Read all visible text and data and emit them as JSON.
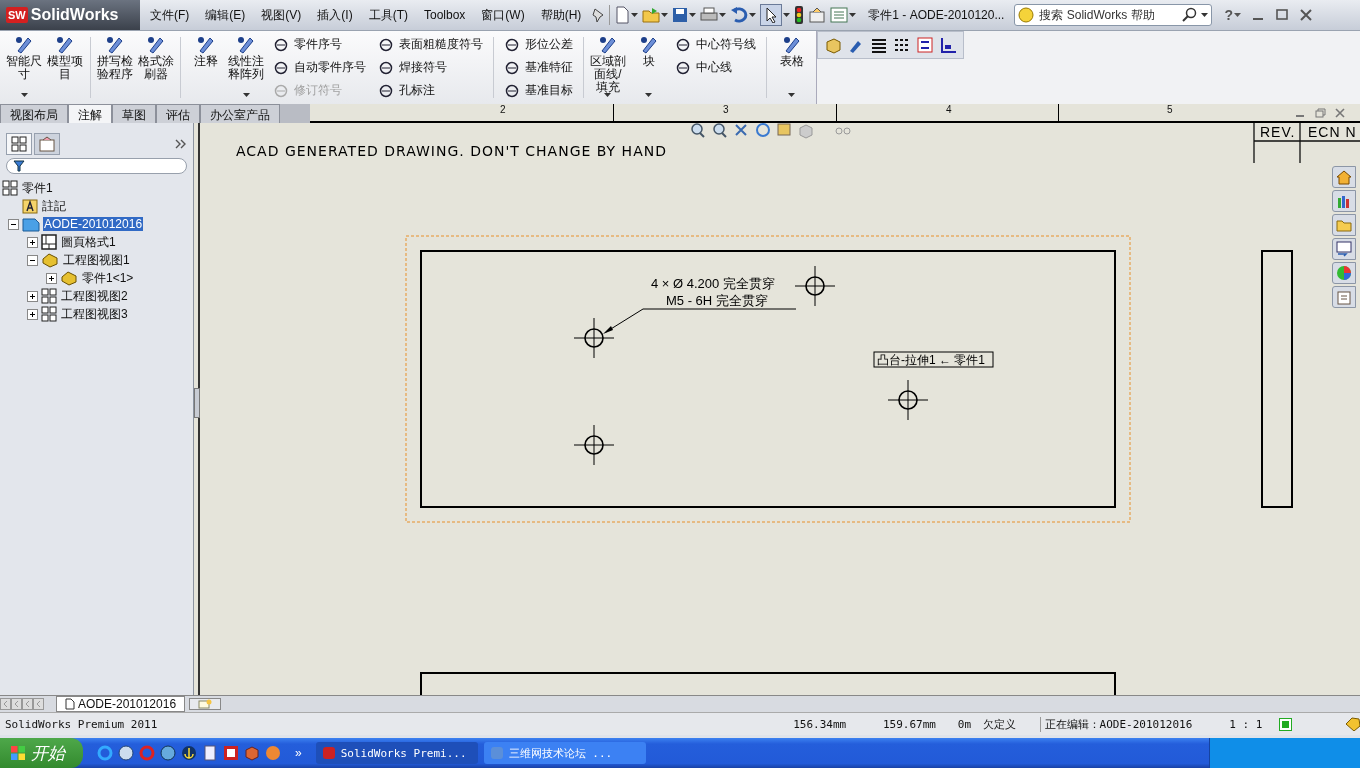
{
  "app": {
    "logo_mark": "SW",
    "logo_name": "SolidWorks"
  },
  "menu": [
    {
      "label": "文件(F)"
    },
    {
      "label": "编辑(E)"
    },
    {
      "label": "视图(V)"
    },
    {
      "label": "插入(I)"
    },
    {
      "label": "工具(T)"
    },
    {
      "label": "Toolbox"
    },
    {
      "label": "窗口(W)"
    },
    {
      "label": "帮助(H)"
    }
  ],
  "document_title": "零件1 - AODE-2010120...",
  "search": {
    "placeholder": "搜索 SolidWorks 帮助"
  },
  "help_button": "?",
  "ribbon": [
    {
      "kind": "large",
      "label": "智能尺寸",
      "caret": true
    },
    {
      "kind": "large",
      "label": "模型项目",
      "caret": false
    },
    {
      "kind": "divider"
    },
    {
      "kind": "large",
      "label": "拼写检验程序",
      "caret": false
    },
    {
      "kind": "large",
      "label": "格式涂刷器",
      "caret": false
    },
    {
      "kind": "divider"
    },
    {
      "kind": "large",
      "label": "注释",
      "caret": false
    },
    {
      "kind": "large",
      "label": "线性注释阵列",
      "caret": true
    },
    {
      "kind": "stack",
      "items": [
        {
          "label": "零件序号",
          "disabled": false
        },
        {
          "label": "自动零件序号",
          "disabled": false
        },
        {
          "label": "修订符号",
          "disabled": true
        }
      ]
    },
    {
      "kind": "stack",
      "items": [
        {
          "label": "表面粗糙度符号",
          "disabled": false
        },
        {
          "label": "焊接符号",
          "disabled": false
        },
        {
          "label": "孔标注",
          "disabled": false
        }
      ]
    },
    {
      "kind": "divider"
    },
    {
      "kind": "stack",
      "items": [
        {
          "label": "形位公差",
          "disabled": false
        },
        {
          "label": "基准特征",
          "disabled": false
        },
        {
          "label": "基准目标",
          "disabled": false
        }
      ]
    },
    {
      "kind": "divider"
    },
    {
      "kind": "large",
      "label": "区域剖面线/填充",
      "caret": true
    },
    {
      "kind": "large",
      "label": "块",
      "caret": true
    },
    {
      "kind": "stack",
      "items": [
        {
          "label": "中心符号线",
          "disabled": false
        },
        {
          "label": "中心线",
          "disabled": false
        }
      ]
    },
    {
      "kind": "divider"
    },
    {
      "kind": "large",
      "label": "表格",
      "caret": true
    }
  ],
  "command_tabs": [
    {
      "label": "视图布局",
      "selected": false
    },
    {
      "label": "注解",
      "selected": true
    },
    {
      "label": "草图",
      "selected": false
    },
    {
      "label": "评估",
      "selected": false
    },
    {
      "label": "办公室产品",
      "selected": false
    }
  ],
  "ruler_labels": [
    "2",
    "3",
    "4",
    "5"
  ],
  "tree": [
    {
      "label": "零件1",
      "kind": "drawing",
      "selected": false,
      "children": [
        {
          "label": "註記",
          "kind": "notes",
          "selected": false
        },
        {
          "label": "AODE-201012016",
          "kind": "sheet",
          "selected": true,
          "expanded": true,
          "children": [
            {
              "label": "圖頁格式1",
              "kind": "format",
              "selected": false,
              "expanded": false
            },
            {
              "label": "工程图视图1",
              "kind": "part",
              "selected": false,
              "expanded": true,
              "children": [
                {
                  "label": "零件1<1>",
                  "kind": "part",
                  "selected": false,
                  "expanded": false
                }
              ]
            },
            {
              "label": "工程图视图2",
              "kind": "view",
              "selected": false,
              "expanded": false
            },
            {
              "label": "工程图视图3",
              "kind": "view",
              "selected": false,
              "expanded": false
            }
          ]
        }
      ]
    }
  ],
  "drawing": {
    "note": "ACAD GENERATED DRAWING. DON'T CHANGE BY HAND",
    "revision_columns": [
      "REV.",
      "ECN N"
    ],
    "hole_callout": [
      "4 × Ø 4.200 完全贯穿",
      "M5 - 6H 完全贯穿"
    ],
    "feature_tag": "凸台-拉伸1 ← 零件1"
  },
  "sheet_tabs": [
    {
      "label": "AODE-201012016",
      "selected": true
    }
  ],
  "status_bar": {
    "product": "SolidWorks Premium 2011",
    "x": "156.34mm",
    "y": "159.67mm",
    "z": "0m",
    "state": "欠定义",
    "editing": "正在编辑：AODE-201012016",
    "scale": "1 : 1"
  },
  "taskbar": {
    "start": "开始",
    "more": "»",
    "tasks": [
      {
        "label": "SolidWorks Premi...",
        "selected": true
      },
      {
        "label": "三维网技术论坛 ...",
        "selected": false
      }
    ]
  }
}
